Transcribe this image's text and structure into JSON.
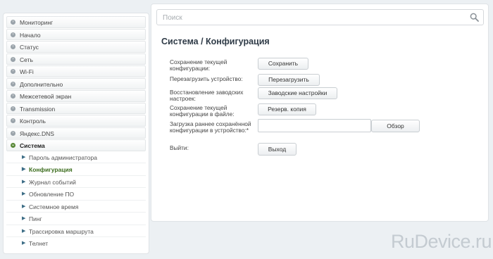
{
  "sidebar": {
    "items": [
      {
        "label": "Мониторинг",
        "icon": "bullet-icon"
      },
      {
        "label": "Начало",
        "icon": "bullet-icon"
      },
      {
        "label": "Статус",
        "icon": "bullet-icon"
      },
      {
        "label": "Сеть",
        "icon": "bullet-icon"
      },
      {
        "label": "Wi-Fi",
        "icon": "bullet-icon"
      },
      {
        "label": "Дополнительно",
        "icon": "bullet-icon"
      },
      {
        "label": "Межсетевой экран",
        "icon": "bullet-icon"
      },
      {
        "label": "Transmission",
        "icon": "bullet-icon"
      },
      {
        "label": "Контроль",
        "icon": "bullet-icon"
      },
      {
        "label": "Яндекс.DNS",
        "icon": "bullet-icon"
      },
      {
        "label": "Система",
        "icon": "expanded-bullet-icon",
        "expanded": true
      }
    ],
    "subitems": [
      {
        "label": "Пароль администратора"
      },
      {
        "label": "Конфигурация",
        "active": true
      },
      {
        "label": "Журнал событий"
      },
      {
        "label": "Обновление ПО"
      },
      {
        "label": "Системное время"
      },
      {
        "label": "Пинг"
      },
      {
        "label": "Трассировка маршрута"
      },
      {
        "label": "Телнет"
      }
    ]
  },
  "search": {
    "placeholder": "Поиск",
    "icon": "search-icon"
  },
  "page": {
    "title": "Система /  Конфигурация"
  },
  "form": {
    "save": {
      "label": "Сохранение текущей конфигурации:",
      "button": "Сохранить"
    },
    "reboot": {
      "label": "Перезагрузить устройство:",
      "button": "Перезагрузить"
    },
    "factory": {
      "label": "Восстановление заводских настроек:",
      "button": "Заводские настройки"
    },
    "backup": {
      "label": "Сохранение текущей конфигурации в файле:",
      "button": "Резерв. копия"
    },
    "upload": {
      "label": "Загрузка раннее сохранённой конфигурации в устройство:*",
      "value": "",
      "button": "Обзор"
    },
    "logout": {
      "label": "Выйти:",
      "button": "Выход"
    }
  },
  "watermark": "RuDevice.ru",
  "colors": {
    "background": "#ecf0f3",
    "active_item": "#3c6d1e",
    "title": "#2f3b47"
  }
}
